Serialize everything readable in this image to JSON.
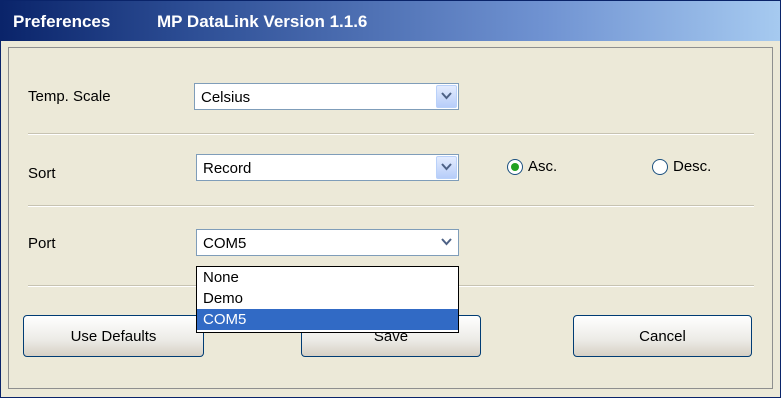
{
  "window": {
    "title": "Preferences",
    "subtitle": "MP DataLink Version 1.1.6"
  },
  "temp_scale": {
    "label": "Temp. Scale",
    "value": "Celsius"
  },
  "sort": {
    "label": "Sort",
    "value": "Record",
    "asc_label": "Asc.",
    "desc_label": "Desc.",
    "selected": "Asc."
  },
  "port": {
    "label": "Port",
    "value": "COM5",
    "options": [
      "None",
      "Demo",
      "COM5"
    ],
    "selected_option": "COM5"
  },
  "buttons": {
    "defaults_label": "Use Defaults",
    "save_label": "Save",
    "cancel_label": "Cancel"
  },
  "colors": {
    "title_bar": "#0A246A",
    "dialog_bg": "#ECE9D8",
    "selection": "#316AC5",
    "radio_dot": "#21A121"
  }
}
